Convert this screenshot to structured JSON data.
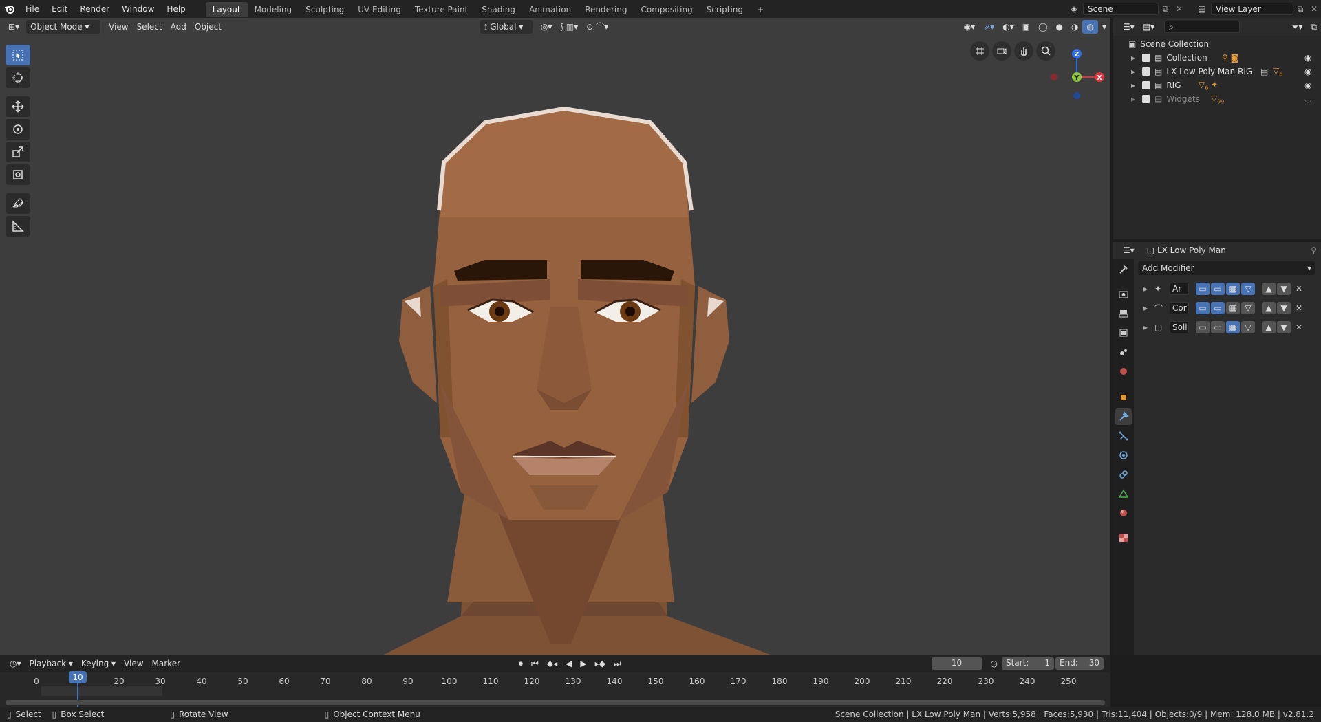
{
  "top_menu": [
    "File",
    "Edit",
    "Render",
    "Window",
    "Help"
  ],
  "workspaces": [
    "Layout",
    "Modeling",
    "Sculpting",
    "UV Editing",
    "Texture Paint",
    "Shading",
    "Animation",
    "Rendering",
    "Compositing",
    "Scripting"
  ],
  "active_workspace": "Layout",
  "scene_name": "Scene",
  "view_layer_name": "View Layer",
  "viewport_header": {
    "mode": "Object Mode",
    "menus": [
      "View",
      "Select",
      "Add",
      "Object"
    ],
    "orientation": "Global"
  },
  "tools": [
    "select-box",
    "cursor",
    "move",
    "rotate",
    "scale",
    "transform",
    "annotate",
    "measure"
  ],
  "gizmo": {
    "z": "Z",
    "y": "Y",
    "x": "X"
  },
  "outliner": {
    "root": "Scene Collection",
    "items": [
      {
        "label": "Collection"
      },
      {
        "label": "LX Low Poly Man RIG"
      },
      {
        "label": "RIG"
      },
      {
        "label": "Widgets"
      }
    ],
    "badges": [
      "6",
      "6",
      "99"
    ]
  },
  "properties": {
    "object_name": "LX Low Poly Man",
    "add_modifier": "Add Modifier",
    "modifiers": [
      {
        "name": "Ar"
      },
      {
        "name": "Cor"
      },
      {
        "name": "Soli"
      }
    ]
  },
  "timeline": {
    "menus": [
      "Playback",
      "Keying",
      "View",
      "Marker"
    ],
    "current_frame": "10",
    "start_label": "Start:",
    "start": "1",
    "end_label": "End:",
    "end": "30",
    "ticks": [
      "0",
      "10",
      "20",
      "30",
      "40",
      "50",
      "60",
      "70",
      "80",
      "90",
      "100",
      "110",
      "120",
      "130",
      "140",
      "150",
      "160",
      "170",
      "180",
      "190",
      "200",
      "210",
      "220",
      "230",
      "240",
      "250"
    ]
  },
  "statusbar": {
    "select": "Select",
    "box_select": "Box Select",
    "rotate_view": "Rotate View",
    "context_menu": "Object Context Menu",
    "info": "Scene Collection | LX Low Poly Man | Verts:5,958 | Faces:5,930 | Tris:11,404 | Objects:0/9 | Mem: 128.0 MB | v2.81.2"
  },
  "colors": {
    "accent": "#4772b3",
    "skin": "#8a5a3c",
    "viewport_bg": "#3d3d3d"
  }
}
